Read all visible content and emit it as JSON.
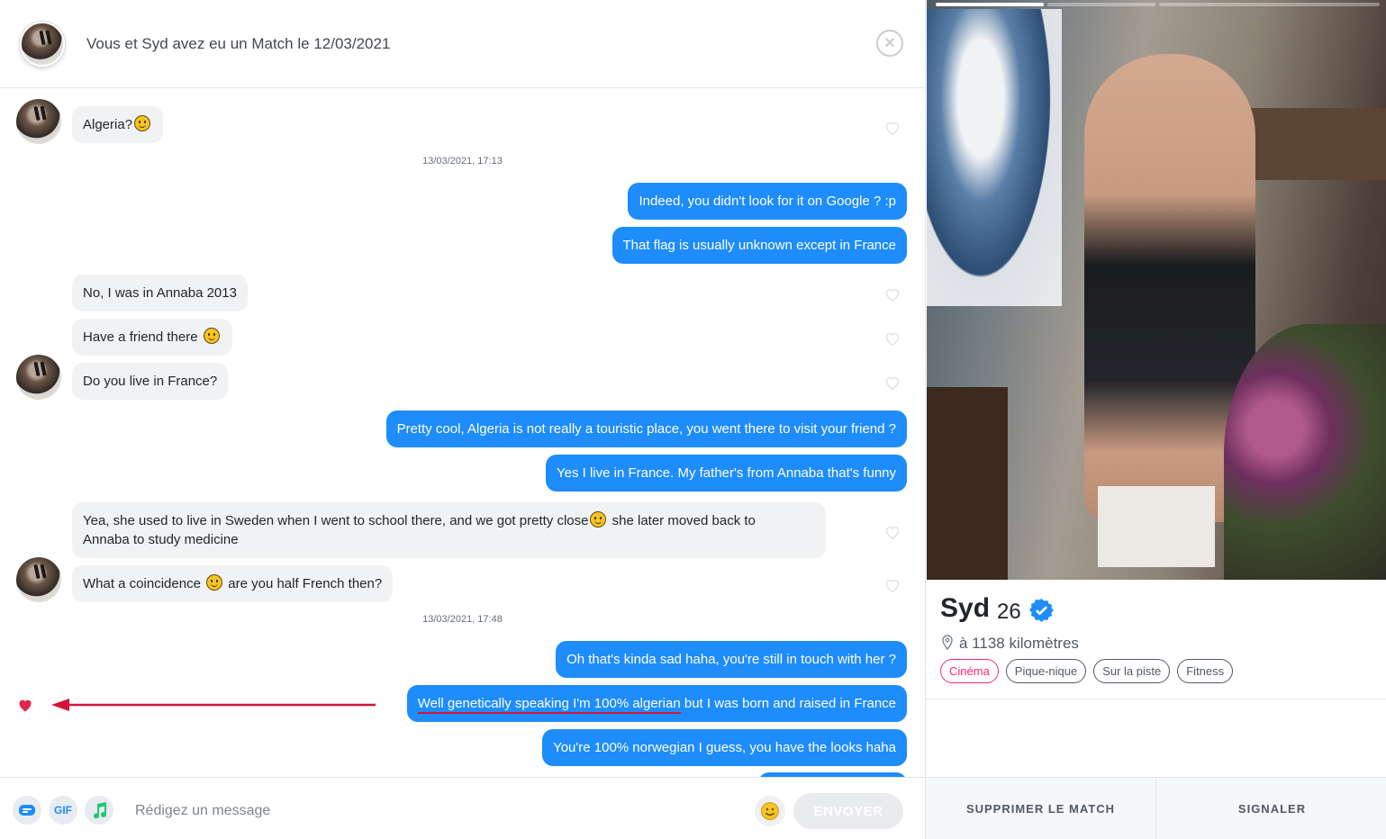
{
  "header": {
    "title": "Vous et Syd avez eu un Match le 12/03/2021",
    "close_icon": "close-icon"
  },
  "messages": [
    {
      "type": "in",
      "text": "Algeria?",
      "emoji_after": true,
      "avatar": true
    },
    {
      "type": "timestamp",
      "text": "13/03/2021, 17:13"
    },
    {
      "type": "out",
      "text": "Indeed, you didn't look for it on Google ? :p"
    },
    {
      "type": "out",
      "text": "That flag is usually unknown except in France"
    },
    {
      "type": "in",
      "text": "No, I was in Annaba 2013"
    },
    {
      "type": "in",
      "text": "Have a friend there"
    },
    {
      "type": "in",
      "text": "Do you live in France?",
      "avatar": true
    },
    {
      "type": "out",
      "text": "Pretty cool, Algeria is not really a touristic place, you went there to visit your friend ?"
    },
    {
      "type": "out",
      "text": "Yes I live in France. My father's from Annaba that's funny"
    },
    {
      "type": "in",
      "text_a": "Yea, she used to live in Sweden when I went to school there, and we got pretty close",
      "text_b": " she later moved back to",
      "text_c": "Annaba to study medicine"
    },
    {
      "type": "in",
      "text_a": "What a coincidence",
      "text_b": "are you half French then?",
      "avatar": true
    },
    {
      "type": "timestamp",
      "text": "13/03/2021, 17:48"
    },
    {
      "type": "out",
      "text": "Oh that's kinda sad haha, you're still in touch with her ?"
    },
    {
      "type": "out",
      "text_underlined": "Well genetically speaking I'm 100% algerian",
      "text_rest": " but I was born and raised in France",
      "liked": true
    },
    {
      "type": "out",
      "text": "You're 100% norwegian I guess, you have the looks haha"
    }
  ],
  "composer": {
    "placeholder": "Rédigez un message",
    "gif_label": "GIF",
    "send_label": "ENVOYER"
  },
  "profile": {
    "name": "Syd",
    "age": "26",
    "distance": "à 1138 kilomètres",
    "interests": [
      "Cinéma",
      "Pique-nique",
      "Sur la piste",
      "Fitness"
    ],
    "photo_count": 3,
    "active_photo_index": 0
  },
  "actions": {
    "delete_match": "SUPPRIMER LE MATCH",
    "report": "SIGNALER"
  },
  "colors": {
    "outgoing_bubble": "#1e8cfa",
    "incoming_bubble": "#f0f2f4",
    "like_heart": "#e0264d",
    "annotation": "#d6123a",
    "brand_pink": "#fd267a",
    "verified": "#1e8cfa"
  }
}
